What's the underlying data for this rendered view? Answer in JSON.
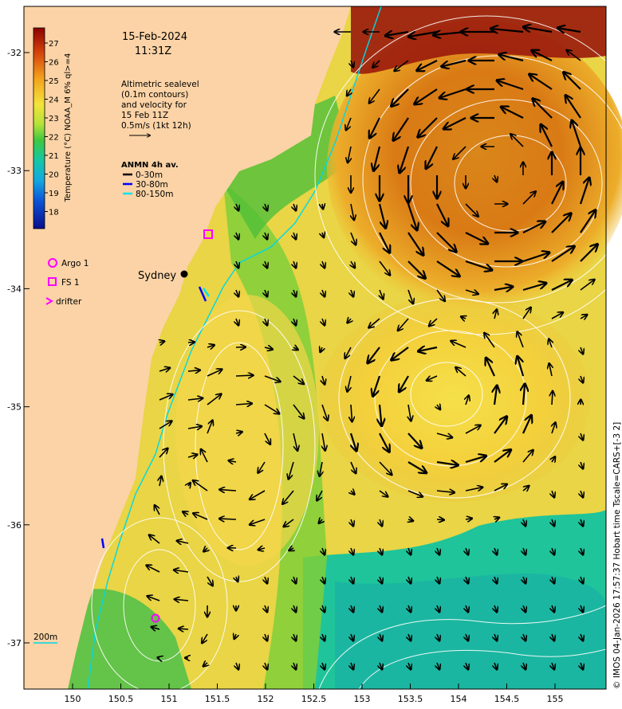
{
  "header": {
    "date": "15-Feb-2024",
    "time": "11:31Z"
  },
  "altimetry_note": {
    "line1": "Altimetric sealevel",
    "line2": "(0.1m contours)",
    "line3": "and velocity for",
    "line4": "15 Feb 11Z",
    "line5": "0.5m/s (1kt 12h)"
  },
  "anmn_legend": {
    "title": "ANMN 4h av.",
    "items": [
      {
        "label": "0-30m",
        "color": "#000000"
      },
      {
        "label": "30-80m",
        "color": "#0000ff"
      },
      {
        "label": "80-150m",
        "color": "#00e5ee"
      }
    ]
  },
  "symbol_legend": {
    "argo": "Argo 1",
    "fs": "FS 1",
    "drifter": "drifter",
    "color": "#ff00ff"
  },
  "place_label": "Sydney",
  "depth_label": "200m",
  "colorbar": {
    "title": "Temperature (°C) NOAA_M 6% ql>=4",
    "ticks": [
      "27",
      "26",
      "25",
      "24",
      "23",
      "22",
      "21",
      "20",
      "19",
      "18"
    ]
  },
  "axes": {
    "x_ticks": [
      "150",
      "150.5",
      "151",
      "151.5",
      "152",
      "152.5",
      "153",
      "153.5",
      "154",
      "154.5",
      "155"
    ],
    "y_ticks": [
      "-32",
      "-33",
      "-34",
      "-35",
      "-36",
      "-37"
    ]
  },
  "credit": "© IMOS 04-Jan-2026 17:57:37 Hobart time Tscale=CARS+[-3 2]",
  "colors": {
    "land": "#fbd3a6",
    "contour": "#ffffff",
    "arrow": "#000000"
  }
}
